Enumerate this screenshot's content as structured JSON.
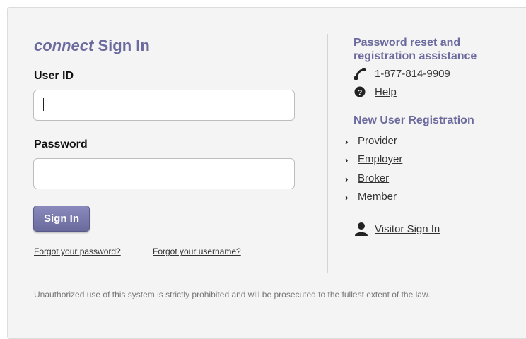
{
  "signin": {
    "title_brand": "connect",
    "title_rest": " Sign In",
    "userid_label": "User ID",
    "userid_value": "",
    "password_label": "Password",
    "password_value": "",
    "button_label": "Sign In",
    "forgot_password": "Forgot your password?",
    "forgot_username": "Forgot your username?"
  },
  "assistance": {
    "heading_line1": "Password reset and",
    "heading_line2": "registration assistance",
    "phone": "1-877-814-9909",
    "help": "Help",
    "phone_icon": "phone-icon",
    "help_icon": "question-circle-icon"
  },
  "registration": {
    "heading": "New User Registration",
    "items": [
      {
        "label": "Provider"
      },
      {
        "label": "Employer"
      },
      {
        "label": "Broker"
      },
      {
        "label": "Member"
      }
    ],
    "chevron_icon": "chevron-right-icon"
  },
  "visitor": {
    "label": "Visitor Sign In",
    "icon": "user-icon"
  },
  "footer": {
    "disclaimer": "Unauthorized use of this system is strictly prohibited and will be prosecuted to the fullest extent of the law."
  },
  "colors": {
    "accent": "#6b6b9e",
    "panel_bg": "#f4f4f4",
    "button_top": "#8a8abc",
    "button_bottom": "#6a6a9c"
  }
}
